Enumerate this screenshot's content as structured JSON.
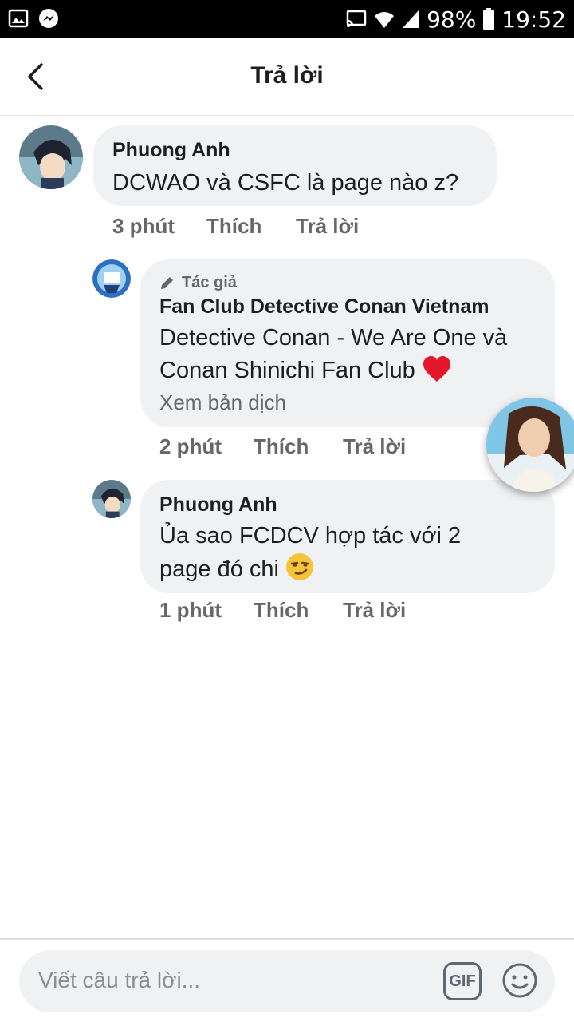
{
  "status_bar": {
    "battery": "98%",
    "time": "19:52"
  },
  "header": {
    "title": "Trả lời"
  },
  "comments": [
    {
      "author": "Phuong Anh",
      "text": "DCWAO và CSFC là page nào z?",
      "time": "3 phút",
      "like": "Thích",
      "reply": "Trả lời"
    },
    {
      "badge": "Tác giả",
      "author": "Fan Club Detective Conan Vietnam",
      "text_line1": "Detective Conan - We Are One và",
      "text_line2": "Conan Shinichi Fan Club",
      "translate": "Xem bản dịch",
      "time": "2 phút",
      "like": "Thích",
      "reply": "Trả lời"
    },
    {
      "author": "Phuong Anh",
      "text_line1": "Ủa sao FCDCV hợp tác với 2",
      "text_line2": "page đó chi",
      "time": "1 phút",
      "like": "Thích",
      "reply": "Trả lời"
    }
  ],
  "composer": {
    "placeholder": "Viết câu trả lời...",
    "gif_label": "GIF"
  }
}
